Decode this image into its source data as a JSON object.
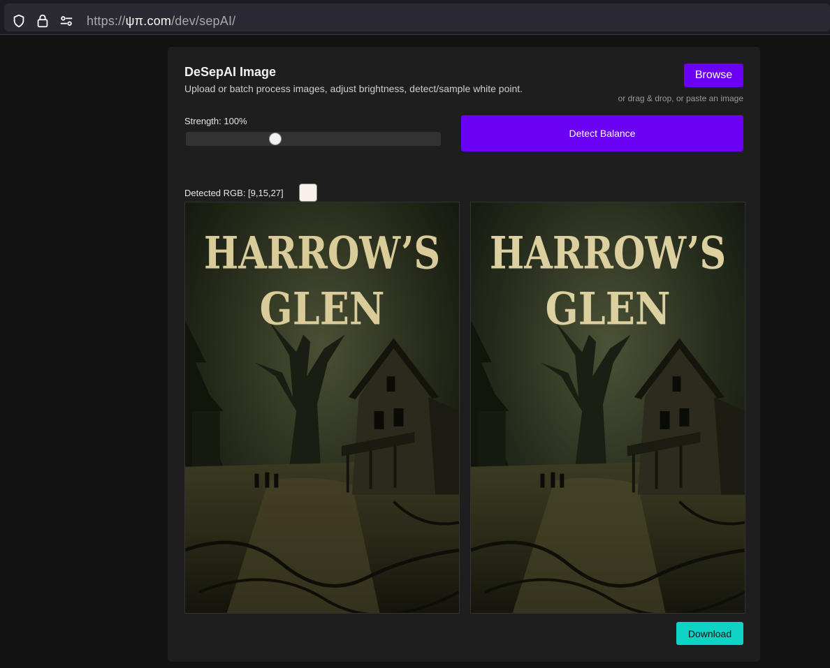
{
  "browser": {
    "url_scheme": "https://",
    "url_host": "ψπ.com",
    "url_path": "/dev/sepAI/",
    "icons": [
      "shield-icon",
      "lock-icon",
      "permissions-icon"
    ]
  },
  "app": {
    "title": "DeSepAI Image",
    "subtitle": "Upload or batch process images, adjust brightness, detect/sample white point.",
    "browse_label": "Browse",
    "drag_hint": "or drag & drop, or paste an image",
    "strength_label": "Strength: 100%",
    "strength_value": 0.35,
    "detect_label": "Detect Balance",
    "detected_rgb_label": "Detected RGB: [9,15,27]",
    "swatch_color": "#f8f1e9",
    "download_label": "Download",
    "accent_color": "#6a00f4",
    "download_color": "#0ed2c4"
  },
  "images": {
    "cover_title_line1": "HARROW’S",
    "cover_title_line2": "GLEN"
  }
}
